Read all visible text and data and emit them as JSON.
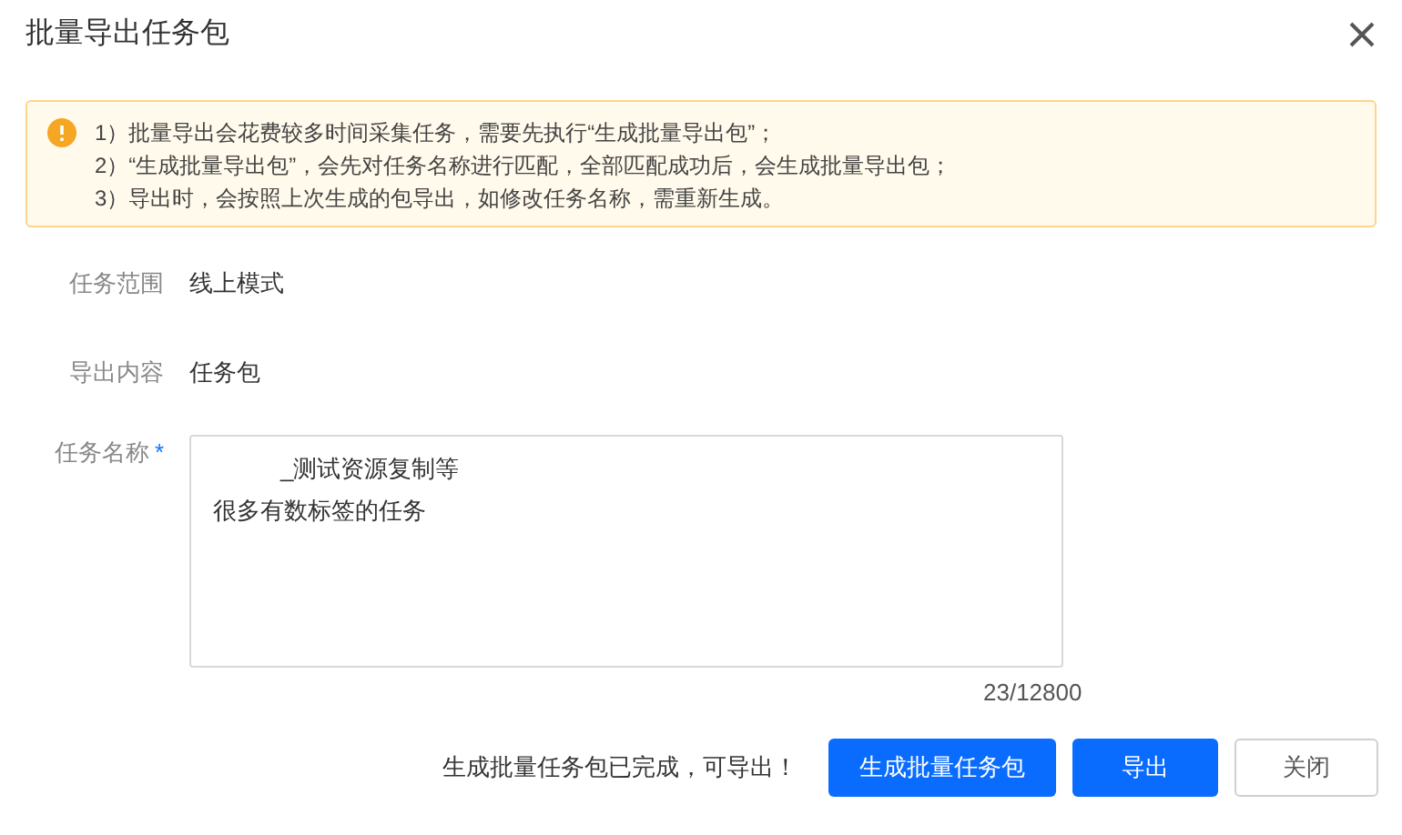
{
  "dialog": {
    "title": "批量导出任务包"
  },
  "notice": {
    "lines": [
      "1）批量导出会花费较多时间采集任务，需要先执行“生成批量导出包”；",
      "2）“生成批量导出包”，会先对任务名称进行匹配，全部匹配成功后，会生成批量导出包；",
      "3）导出时，会按照上次生成的包导出，如修改任务名称，需重新生成。"
    ]
  },
  "fields": [
    {
      "kind": "text",
      "label": "任务范围",
      "value": "线上模式"
    },
    {
      "kind": "text",
      "label": "导出内容",
      "value": "任务包"
    },
    {
      "kind": "textarea",
      "label": "任务名称",
      "required_mark": "*",
      "lines": [
        "_测试资源复制等",
        "很多有数标签的任务"
      ],
      "counter": "23/12800"
    }
  ],
  "footer": {
    "status": "生成批量任务包已完成，可导出！",
    "buttons": [
      {
        "label": "生成批量任务包",
        "kind": "primary"
      },
      {
        "label": "导出",
        "kind": "primary"
      },
      {
        "label": "关闭",
        "kind": "default"
      }
    ]
  }
}
